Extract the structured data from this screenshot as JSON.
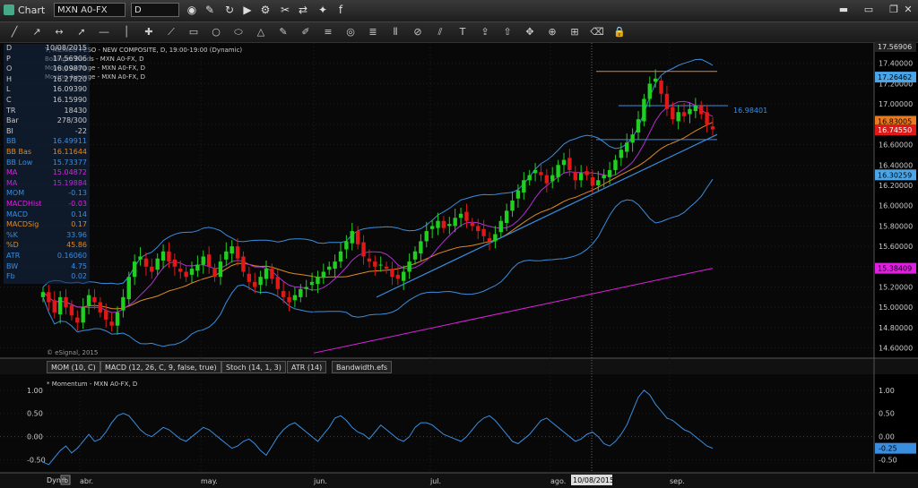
{
  "window": {
    "title": "Chart"
  },
  "toolbar": {
    "symbol": "MXN A0-FX",
    "interval": "D",
    "icons": [
      "chart-icon",
      "draw-icon",
      "refresh-icon",
      "play-icon",
      "settings-icon",
      "tools-icon",
      "link-icon",
      "twitter-icon",
      "facebook-icon"
    ]
  },
  "drawing_tools": [
    "line",
    "ray",
    "extended-line",
    "arrow",
    "horizontal-line",
    "vertical-line",
    "cross",
    "polyline",
    "rectangle",
    "circle",
    "ellipse",
    "triangle",
    "pencil",
    "brush",
    "fibonacci",
    "gann",
    "cycle",
    "andrews",
    "regression",
    "channel",
    "text",
    "callout",
    "cursor",
    "pan",
    "zoom",
    "measure",
    "eraser",
    "lock"
  ],
  "price_panel": {
    "header_lines": [
      "T, MEXICO PESO - NEW COMPOSITE, D, 19:00-19:00 (Dynamic)",
      "Bollinger Bands - MXN A0-FX, D",
      "Moving Average - MXN A0-FX, D",
      "Moving Average - MXN A0-FX, D"
    ],
    "watermark": "© eSignal, 2015",
    "y_ticks": [
      "17.40000",
      "17.20000",
      "17.00000",
      "16.80000",
      "16.60000",
      "16.40000",
      "16.20000",
      "16.00000",
      "15.80000",
      "15.60000",
      "15.40000",
      "15.20000",
      "15.00000",
      "14.80000",
      "14.60000"
    ],
    "y_tick_values": [
      17.4,
      17.2,
      17.0,
      16.8,
      16.6,
      16.4,
      16.2,
      16.0,
      15.8,
      15.6,
      15.4,
      15.2,
      15.0,
      14.8,
      14.6
    ],
    "price_labels": [
      {
        "text": "17.56906",
        "value": 17.56906,
        "color": "#dddddd",
        "bg": "#222222"
      },
      {
        "text": "17.26462",
        "value": 17.26462,
        "color": "#000000",
        "bg": "#4aa6e8"
      },
      {
        "text": "16.83005",
        "value": 16.83005,
        "color": "#000000",
        "bg": "#e87a20"
      },
      {
        "text": "16.74550",
        "value": 16.7455,
        "color": "#ffffff",
        "bg": "#e01818"
      },
      {
        "text": "16.30259",
        "value": 16.30259,
        "color": "#000000",
        "bg": "#4aa6e8"
      },
      {
        "text": "15.38409",
        "value": 15.38409,
        "color": "#000000",
        "bg": "#e020e0"
      }
    ],
    "annotation": "16.98401",
    "line_colors": {
      "bollinger": "#3a8ee0",
      "ma_fast": "#b030d0",
      "ma_mid": "#e08a20",
      "ma_slow": "#e020e0",
      "trend": "#3a8ee0",
      "level_orange": "#e08a20",
      "level_blue": "#3a8ee0",
      "up": "#20d020",
      "down": "#e01818"
    }
  },
  "data_window": [
    {
      "k": "D",
      "v": "10/08/2015",
      "color": "#cccccc"
    },
    {
      "k": "P",
      "v": "17.56906",
      "color": "#cccccc"
    },
    {
      "k": "O",
      "v": "16.09870",
      "color": "#cccccc"
    },
    {
      "k": "H",
      "v": "16.27820",
      "color": "#cccccc"
    },
    {
      "k": "L",
      "v": "16.09390",
      "color": "#cccccc"
    },
    {
      "k": "C",
      "v": "16.15990",
      "color": "#cccccc"
    },
    {
      "k": "TR",
      "v": "18430",
      "color": "#cccccc"
    },
    {
      "k": "Bar",
      "v": "278/300",
      "color": "#cccccc"
    },
    {
      "k": "BI",
      "v": "-22",
      "color": "#cccccc"
    },
    {
      "k": "BB",
      "v": "16.49911",
      "color": "#3a8ee0"
    },
    {
      "k": "BB Bas",
      "v": "16.11644",
      "color": "#e08a20"
    },
    {
      "k": "BB Low",
      "v": "15.73377",
      "color": "#3a8ee0"
    },
    {
      "k": "MA",
      "v": "15.04872",
      "color": "#e020e0"
    },
    {
      "k": "MA",
      "v": "15.19884",
      "color": "#b030d0"
    },
    {
      "k": "MOM",
      "v": "-0.13",
      "color": "#3a8ee0"
    },
    {
      "k": "MACDHist",
      "v": "-0.03",
      "color": "#e020e0"
    },
    {
      "k": "MACD",
      "v": "0.14",
      "color": "#3a8ee0"
    },
    {
      "k": "MACDSig",
      "v": "0.17",
      "color": "#e08a20"
    },
    {
      "k": "%K",
      "v": "33.96",
      "color": "#3a8ee0"
    },
    {
      "k": "%D",
      "v": "45.86",
      "color": "#e08a20"
    },
    {
      "k": "ATR",
      "v": "0.16060",
      "color": "#3a8ee0"
    },
    {
      "k": "BW",
      "v": "4.75",
      "color": "#3a8ee0"
    },
    {
      "k": "Fb",
      "v": "0.02",
      "color": "#3a8ee0"
    }
  ],
  "tabs": [
    "MOM (10, C)",
    "MACD (12, 26, C, 9, false, true)",
    "Stoch (14, 1, 3)",
    "ATR (14)",
    "Bandwidth.efs"
  ],
  "momentum_panel": {
    "title": "* Momentum - MXN A0-FX, D",
    "y_ticks": [
      "1.00",
      "0.50",
      "0.00",
      "-0.50"
    ],
    "y_tick_values": [
      1.0,
      0.5,
      0.0,
      -0.5
    ],
    "last_label": "-0.25",
    "last_value": -0.25
  },
  "x_axis": {
    "labels": [
      "abr.",
      "may.",
      "jun.",
      "jul.",
      "ago.",
      "sep."
    ],
    "cursor_date": "10/08/2015",
    "dyn_label": "Dyn",
    "fb_label": "fb"
  },
  "chart_data": {
    "type": "candlestick",
    "months": [
      "abr.",
      "may.",
      "jun.",
      "jul.",
      "ago.",
      "sep."
    ],
    "ylim": [
      14.5,
      17.6
    ],
    "series": [
      {
        "name": "close",
        "values": [
          15.15,
          15.05,
          14.95,
          15.1,
          15.0,
          14.92,
          14.85,
          15.0,
          15.12,
          15.05,
          14.95,
          14.88,
          14.82,
          14.95,
          15.1,
          15.3,
          15.45,
          15.5,
          15.4,
          15.35,
          15.48,
          15.55,
          15.45,
          15.4,
          15.35,
          15.3,
          15.38,
          15.42,
          15.5,
          15.4,
          15.3,
          15.45,
          15.55,
          15.6,
          15.48,
          15.35,
          15.25,
          15.2,
          15.3,
          15.38,
          15.28,
          15.18,
          15.1,
          15.05,
          15.12,
          15.18,
          15.2,
          15.25,
          15.3,
          15.35,
          15.4,
          15.45,
          15.55,
          15.65,
          15.75,
          15.62,
          15.5,
          15.45,
          15.4,
          15.42,
          15.38,
          15.3,
          15.28,
          15.35,
          15.45,
          15.55,
          15.65,
          15.75,
          15.8,
          15.85,
          15.78,
          15.82,
          15.88,
          15.92,
          15.85,
          15.8,
          15.75,
          15.7,
          15.65,
          15.72,
          15.85,
          15.95,
          16.05,
          16.15,
          16.25,
          16.3,
          16.35,
          16.3,
          16.22,
          16.3,
          16.4,
          16.45,
          16.35,
          16.25,
          16.32,
          16.3,
          16.2,
          16.25,
          16.3,
          16.35,
          16.45,
          16.55,
          16.62,
          16.7,
          16.85,
          17.05,
          17.2,
          17.25,
          17.1,
          16.95,
          16.85,
          16.92,
          16.88,
          16.95,
          16.98,
          16.9,
          16.8,
          16.75
        ]
      }
    ],
    "momentum": [
      -0.55,
      -0.6,
      -0.45,
      -0.3,
      -0.2,
      -0.35,
      -0.25,
      -0.1,
      0.05,
      -0.1,
      -0.05,
      0.1,
      0.3,
      0.45,
      0.5,
      0.45,
      0.3,
      0.15,
      0.05,
      0.0,
      0.1,
      0.2,
      0.15,
      0.05,
      -0.05,
      -0.1,
      0.0,
      0.1,
      0.2,
      0.15,
      0.05,
      -0.05,
      -0.15,
      -0.25,
      -0.2,
      -0.1,
      -0.05,
      -0.15,
      -0.3,
      -0.4,
      -0.2,
      0.0,
      0.15,
      0.25,
      0.3,
      0.2,
      0.1,
      0.0,
      -0.1,
      0.05,
      0.2,
      0.4,
      0.45,
      0.35,
      0.2,
      0.1,
      0.05,
      -0.05,
      0.1,
      0.25,
      0.15,
      0.05,
      -0.05,
      -0.1,
      0.0,
      0.2,
      0.3,
      0.3,
      0.25,
      0.15,
      0.05,
      0.0,
      -0.05,
      -0.1,
      0.0,
      0.15,
      0.3,
      0.4,
      0.45,
      0.35,
      0.2,
      0.05,
      -0.1,
      -0.15,
      -0.05,
      0.05,
      0.2,
      0.35,
      0.4,
      0.3,
      0.2,
      0.1,
      0.0,
      -0.1,
      -0.05,
      0.05,
      0.1,
      0.0,
      -0.15,
      -0.2,
      -0.1,
      0.05,
      0.25,
      0.55,
      0.85,
      1.0,
      0.9,
      0.7,
      0.55,
      0.4,
      0.35,
      0.25,
      0.15,
      0.1,
      0.0,
      -0.1,
      -0.2,
      -0.25
    ]
  }
}
